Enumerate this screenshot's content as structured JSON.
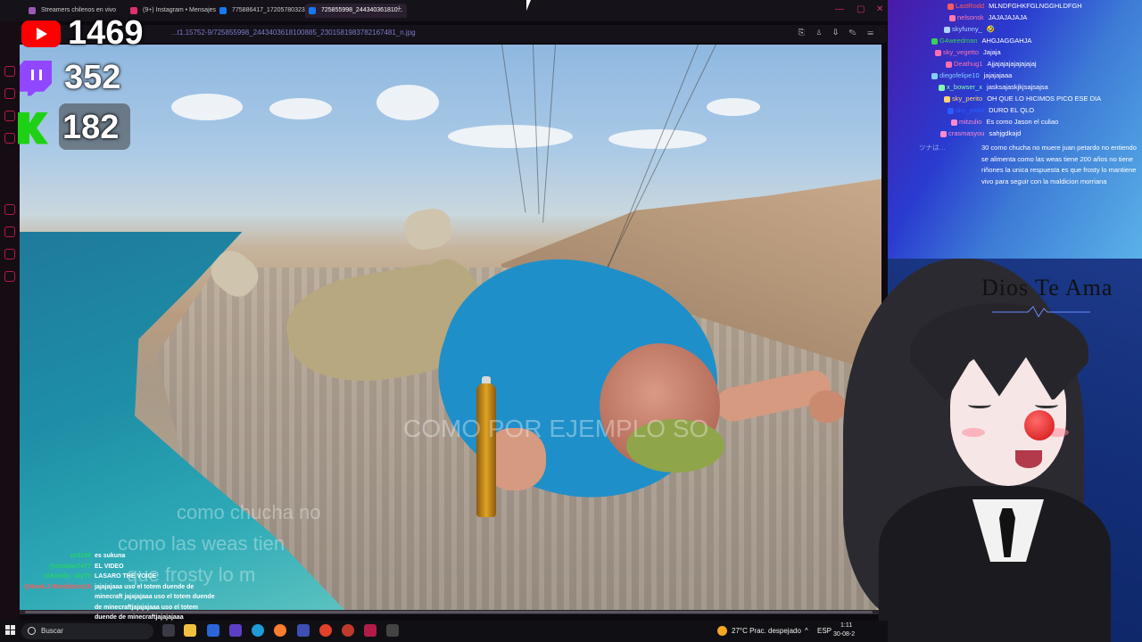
{
  "browser": {
    "tabs": [
      {
        "label": "Streamers chilenos en vivo",
        "color": "#9b59b6"
      },
      {
        "label": "(9+) Instagram • Mensajes",
        "color": "#e1306c"
      },
      {
        "label": "775886417_1720578032301...",
        "color": "#1877f2"
      },
      {
        "label": "725855998_244340361810...",
        "color": "#1877f2"
      }
    ],
    "url": "...t1.15752-9/725855998_2443403618100885_2301581983782167481_n.jpg"
  },
  "counters": {
    "youtube": "1469",
    "twitch": "352",
    "kick": "182"
  },
  "stage": {
    "overlay_lines": [
      "COMO POR EJEMPLO SO",
      "como chucha no",
      "como las weas tien",
      "que frosty lo m"
    ]
  },
  "chat": {
    "messages": [
      {
        "user": "LastRodd",
        "text": "MLNDFGHKFGLNGGHLDFGH",
        "ucolor": "#ff5a5a"
      },
      {
        "user": "nelsonsk",
        "text": "JAJAJAJAJA",
        "ucolor": "#ff7ab0"
      },
      {
        "user": "skyfunny_",
        "text": "🤣",
        "ucolor": "#aad4ff"
      },
      {
        "user": "G4weedman",
        "text": "AHGJAGGAHJA",
        "ucolor": "#35d15a"
      },
      {
        "user": "sky_vegetto",
        "text": "Jajaja",
        "ucolor": "#ff6fb0"
      },
      {
        "user": "Deathug1",
        "text": "Ajjajajajajajajajaj",
        "ucolor": "#ff6fb0"
      },
      {
        "user": "diegofelipe10",
        "text": "jajajajaaa",
        "ucolor": "#7fd0ff"
      },
      {
        "user": "x_bowser_x",
        "text": "jasksajaskjkjsajsajsa",
        "ucolor": "#7fffb0"
      },
      {
        "user": "sky_perito",
        "text": "OH QUE LO HICIMOS PICO ESE DIA",
        "ucolor": "#ffd36f"
      },
      {
        "user": "sky_pa8a",
        "text": "DURO EL QLO",
        "ucolor": "#2b5cff"
      },
      {
        "user": "mitzulio",
        "text": "Es como Jason el culiao",
        "ucolor": "#ff8ad0"
      },
      {
        "user": "crasmasyou",
        "text": "sahjgdkajd",
        "ucolor": "#ff8ad0"
      }
    ],
    "long_user": "ツナは…",
    "long_message": "30 como chucha no muere juan petardo no entiendo se alimenta como las weas tiene 200 años no tiene riñones la unica respuesta es que frosty lo mantiene vivo para seguir con la maldicion morriana"
  },
  "avatar": {
    "caption": "Dios Te Ama"
  },
  "mini_chat": [
    {
      "user": "xn3108",
      "text": "es sukuna"
    },
    {
      "user": "@cristian7477",
      "text": "EL VIDEO"
    },
    {
      "user": "@kamilo_sky79",
      "text": "LASARO THE VOICE"
    },
    {
      "user": "@Hank.J.Wimbleton18",
      "text": "jajajajaaa uso el totem duende de minecraft jajajajaaa uso el totem duende de minecraftjajajajaaa uso el totem duende de minecraftjajajajaaa"
    }
  ],
  "taskbar": {
    "search_placeholder": "Buscar",
    "weather": "27°C  Prac. despejado",
    "lang": "ESP",
    "time": "1:11",
    "date": "30-08-2"
  },
  "colors": {
    "youtube": "#ff0000",
    "twitch": "#9146ff",
    "kick": "#1fd114",
    "accent": "#b21c46"
  },
  "icons": [
    "play-icon",
    "twitch-icon",
    "kick-icon",
    "search-icon",
    "windows-icon",
    "weather-icon",
    "chevron-up-icon"
  ]
}
